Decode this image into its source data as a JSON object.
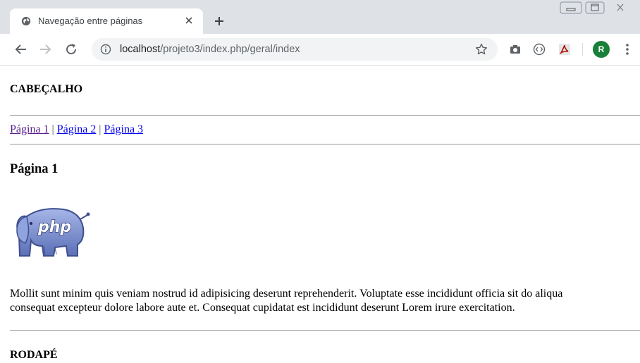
{
  "browser": {
    "tab": {
      "title": "Navegação entre páginas"
    },
    "address": {
      "host": "localhost",
      "path": "/projeto3/index.php/geral/index"
    },
    "profile_initial": "R",
    "icons": {
      "favicon": "globe-icon",
      "tab_close": "close-icon",
      "new_tab": "plus-icon",
      "back": "back-arrow-icon",
      "forward": "forward-arrow-icon",
      "reload": "reload-icon",
      "site_info": "info-icon",
      "bookmark": "star-icon",
      "extensions": [
        "camera-icon",
        "code-icon",
        "pdf-icon"
      ],
      "menu": "kebab-menu-icon"
    },
    "colors": {
      "titlebar": "#dee1e6",
      "omnibox": "#f1f3f4",
      "profile": "#188038"
    }
  },
  "page": {
    "header": "CABEÇALHO",
    "nav": {
      "links": [
        "Página 1",
        "Página 2",
        "Página 3"
      ],
      "separator": "|"
    },
    "heading": "Página 1",
    "logo": {
      "text": "php",
      "icon": "php-elephant-logo"
    },
    "paragraph": {
      "line1": "Mollit sunt minim quis veniam nostrud id adipisicing deserunt reprehenderit. Voluptate esse incididunt officia sit do aliqua",
      "line2": "consequat excepteur dolore labore aute et. Consequat cupidatat est incididunt deserunt Lorem irure exercitation."
    },
    "footer": "RODAPÉ",
    "colors": {
      "visited_link": "#551a8b",
      "link": "#0000ee"
    }
  }
}
